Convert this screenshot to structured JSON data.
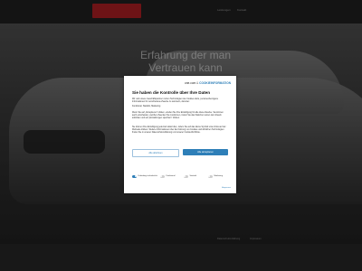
{
  "site": {
    "nav": [
      "Leistungen",
      "Kontakt"
    ],
    "hero_lines": [
      "Erfahrung der man",
      "Vertrauen kann"
    ],
    "footer_links": [
      "Datenschutzerklärung",
      "Impressum"
    ]
  },
  "consent": {
    "brand": "one.com",
    "brand_sep": "&",
    "brand_partner": "COOKIEINFORMATION",
    "title": "Sie haben die Kontrolle über Ihre Daten",
    "para1": "Wir und unsere Geschäftspartner nutzen Technologien wie Cookies dazu, personenbezogene Informationen für verschiedene Zwecke zu sammeln, darunter:",
    "para2": "Funktional, Statistik, Marketing",
    "para3": "Wenn Sie auf „Akzeptieren“ klicken, erteilen Sie Ihre Einwilligung für alle diese Zwecke. Sie können auch entscheiden, welchen Zwecken Sie zustimmen, indem Sie das Kästchen neben dem Zweck anklicken und auf „Einstellungen speichern“ klicken.",
    "para4": "Sie können Ihre Einwilligung jederzeit widerrufen, indem Sie auf das kleine Symbol unten links auf der Webseite klicken. Weitere Informationen über die Nutzung von Cookies und ähnlichen Technologien finden Sie in unserer Datenschutzerklärung und unserer Cookie-Richtlinie.",
    "reject_label": "Alle ablehnen",
    "accept_label": "Alle akzeptieren",
    "toggles": [
      {
        "label": "Unbedingt erforderlich",
        "on": true
      },
      {
        "label": "Funktional",
        "on": false
      },
      {
        "label": "Statistik",
        "on": false
      },
      {
        "label": "Marketing",
        "on": false
      }
    ],
    "customize_label": "Anpassen"
  },
  "colors": {
    "accent": "#2e7fb8",
    "logo": "#a91e22"
  }
}
